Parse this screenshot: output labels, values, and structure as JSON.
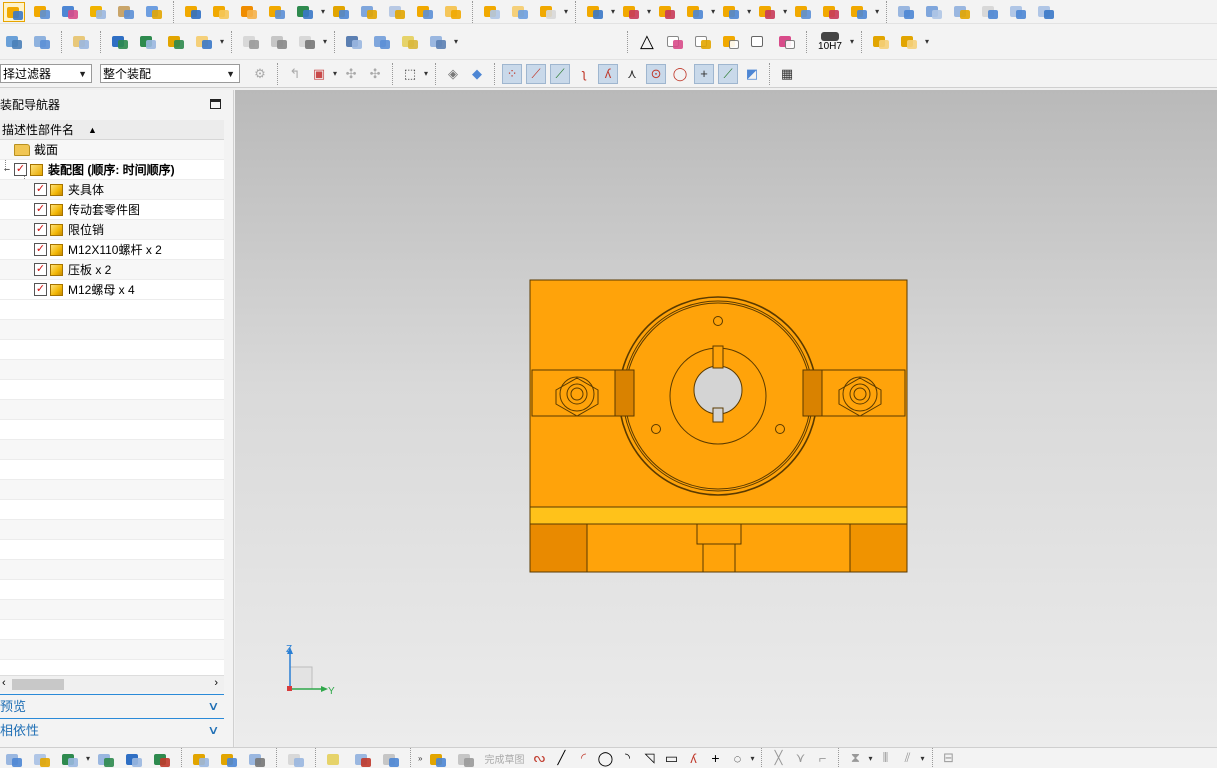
{
  "toolbar": {
    "filter_label": "择过滤器",
    "assembly_scope_label": "整个装配",
    "tolerance_label": "10H7"
  },
  "navigator": {
    "title": "装配导航器",
    "column_header": "描述性部件名",
    "section_node": "截面",
    "root_node": "装配图 (顺序: 时间顺序)",
    "parts": [
      {
        "label": "夹具体",
        "checked": true
      },
      {
        "label": "传动套零件图",
        "checked": true
      },
      {
        "label": "限位销",
        "checked": true
      },
      {
        "label": "M12X110螺杆 x 2",
        "checked": true
      },
      {
        "label": "压板 x 2",
        "checked": true
      },
      {
        "label": "M12螺母 x 4",
        "checked": true
      }
    ],
    "preview_label": "预览",
    "dependency_label": "相依性"
  },
  "triad": {
    "z_label": "Z",
    "y_label": "Y"
  },
  "bottom_toolbar": {
    "finish_sketch_label": "完成草图"
  },
  "colors": {
    "part_orange": "#ffa30a",
    "part_dark": "#e98a00",
    "accent_blue": "#1f6fb5",
    "check_red": "#d01010"
  }
}
